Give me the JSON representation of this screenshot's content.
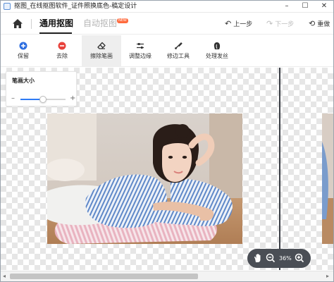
{
  "window": {
    "title": "抠图_在线抠图软件_证件照换底色-稿定设计",
    "minimize_glyph": "–",
    "maximize_glyph": "☐",
    "close_glyph": "✕"
  },
  "header": {
    "tab_general": "通用抠图",
    "tab_auto": "自动抠图",
    "badge": "NEW",
    "undo": "上一步",
    "redo": "下一步",
    "reset": "重做"
  },
  "toolbar": {
    "tools": [
      {
        "label": "保留",
        "icon": "plus-circle-icon"
      },
      {
        "label": "去除",
        "icon": "minus-circle-icon"
      },
      {
        "label": "擦除笔画",
        "icon": "eraser-icon"
      },
      {
        "label": "调整边缘",
        "icon": "sliders-icon"
      },
      {
        "label": "修边工具",
        "icon": "edge-brush-icon"
      },
      {
        "label": "处理发丝",
        "icon": "hair-icon"
      }
    ],
    "active_tool": "擦除笔画"
  },
  "brush": {
    "title": "笔画大小",
    "minus": "–",
    "plus": "+",
    "value_fraction": 0.5
  },
  "zoom": {
    "level": "36%"
  },
  "colors": {
    "accent": "#2f7bf5",
    "keep": "#2f6fe0",
    "remove": "#e8423c",
    "badge": "#ff6a3d",
    "zoom_bg": "#4a4e55"
  }
}
